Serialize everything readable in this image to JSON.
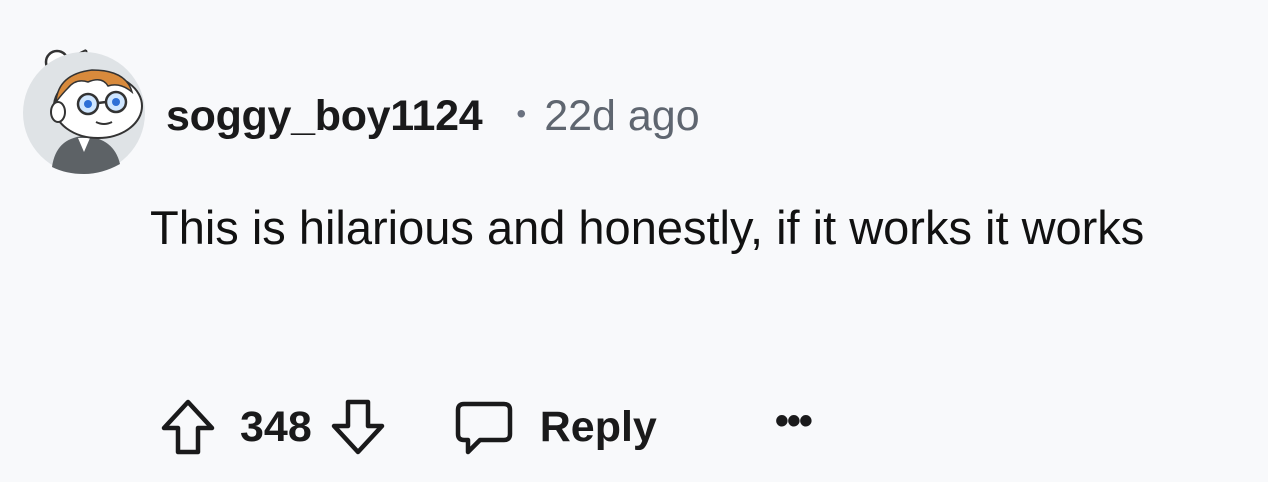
{
  "comment": {
    "username": "soggy_boy1124",
    "separator": "•",
    "time": "22d ago",
    "text": "This is hilarious and honestly, if it works it works",
    "score": "348",
    "reply_label": "Reply",
    "more_label": "•••"
  },
  "icons": {
    "avatar": "snoo-avatar",
    "upvote": "arrow-up-icon",
    "downvote": "arrow-down-icon",
    "reply": "speech-bubble-icon",
    "more": "ellipsis-icon"
  }
}
